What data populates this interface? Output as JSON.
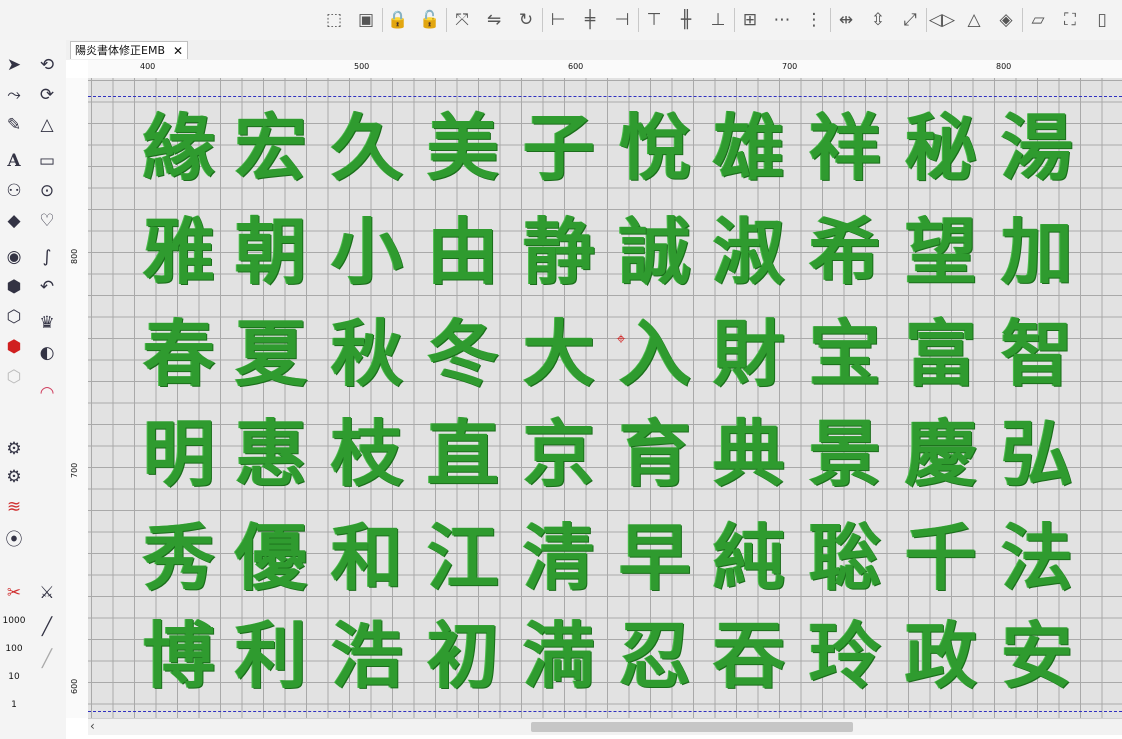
{
  "document": {
    "tab_label": "陽炎書体修正EMB",
    "close_glyph": "✕"
  },
  "toolbar": {
    "icons": [
      "select-grid-icon",
      "group-icon",
      "lock-icon",
      "unlock-icon",
      "transform-icon",
      "mirror-icon",
      "rotate-icon",
      "align-left-icon",
      "align-center-icon",
      "align-right-icon",
      "align-top-icon",
      "align-middle-icon",
      "align-bottom-icon",
      "center-icon",
      "distribute-h-icon",
      "distribute-v-icon",
      "space-h-icon",
      "space-v-icon",
      "size-icon",
      "flip-h-icon",
      "flip-v-icon",
      "flip-both-icon",
      "skew-icon",
      "fit-icon",
      "more-icon"
    ]
  },
  "left_panel": {
    "tools": [
      "select-arrow-icon",
      "reshape-node-icon",
      "pen-icon",
      "text-tool-icon",
      "team-names-icon",
      "monogram-icon",
      "satin-circle-icon",
      "fill-hexagon-icon",
      "outline-hexagon-icon",
      "red-hexagon-icon",
      "gray-hexagon-icon",
      "curve-closed-icon",
      "curve-open-icon",
      "node-edit-icon",
      "rectangle-icon",
      "ellipse-icon",
      "shapes-icon",
      "freehand-icon",
      "back-arrow-icon",
      "crown-icon",
      "palette-icon",
      "lace-icon",
      "stitch-player-icon",
      "stitch-run-icon",
      "zigzag-icon",
      "motif-icon",
      "cut-icon",
      "knife-icon",
      "needle-icon",
      "needle-gray-icon"
    ],
    "stitch_counts": [
      "1000",
      "100",
      "10",
      "1"
    ]
  },
  "rulers": {
    "horizontal_labels": [
      "400",
      "500",
      "600",
      "700",
      "800"
    ],
    "vertical_labels": [
      "800",
      "700",
      "600"
    ]
  },
  "design": {
    "color": "#2f9b2f",
    "rows": [
      [
        "緣",
        "宏",
        "久",
        "美",
        "子",
        "悅",
        "雄",
        "祥",
        "秘",
        "湯"
      ],
      [
        "雅",
        "朝",
        "小",
        "由",
        "静",
        "誠",
        "淑",
        "希",
        "望",
        "加"
      ],
      [
        "春",
        "夏",
        "秋",
        "冬",
        "大",
        "入",
        "財",
        "宝",
        "富",
        "智"
      ],
      [
        "明",
        "惠",
        "枝",
        "直",
        "京",
        "育",
        "典",
        "景",
        "慶",
        "弘"
      ],
      [
        "秀",
        "優",
        "和",
        "江",
        "清",
        "早",
        "純",
        "聡",
        "千",
        "法"
      ],
      [
        "博",
        "利",
        "浩",
        "初",
        "満",
        "忍",
        "吞",
        "玲",
        "政",
        "安"
      ]
    ]
  }
}
